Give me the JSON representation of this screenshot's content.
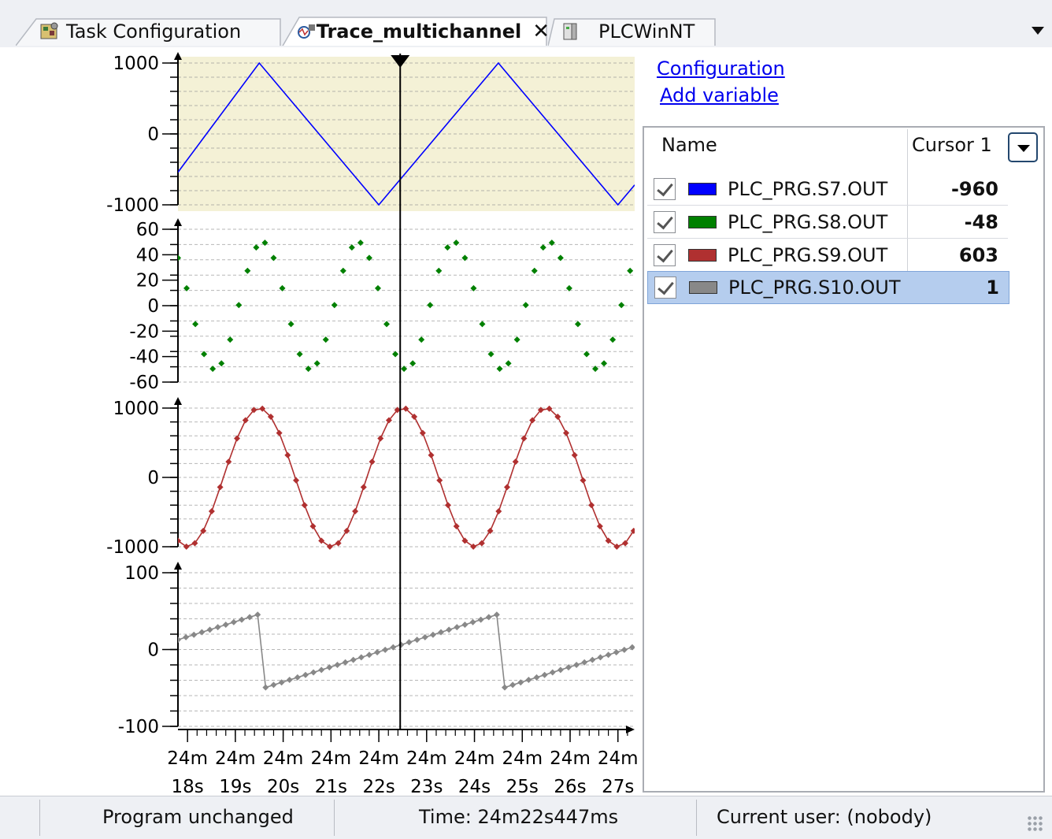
{
  "tabs": [
    {
      "label": "Task Configuration",
      "icon": "task-config-icon",
      "active": false
    },
    {
      "label": "Trace_multichannel",
      "icon": "trace-icon",
      "active": true
    },
    {
      "label": "PLCWinNT",
      "icon": "plc-device-icon",
      "active": false
    }
  ],
  "links": {
    "configuration": "Configuration",
    "add_variable": "Add variable"
  },
  "variable_list": {
    "col_name": "Name",
    "col_cursor": "Cursor 1",
    "rows": [
      {
        "name": "PLC_PRG.S7.OUT",
        "color": "#0000ff",
        "value": "-960",
        "checked": true,
        "selected": false
      },
      {
        "name": "PLC_PRG.S8.OUT",
        "color": "#008000",
        "value": "-48",
        "checked": true,
        "selected": false
      },
      {
        "name": "PLC_PRG.S9.OUT",
        "color": "#b03030",
        "value": "603",
        "checked": true,
        "selected": false
      },
      {
        "name": "PLC_PRG.S10.OUT",
        "color": "#888888",
        "value": "1",
        "checked": true,
        "selected": true
      }
    ]
  },
  "status": {
    "program": "Program unchanged",
    "time": "Time: 24m22s447ms",
    "user": "Current user: (nobody)"
  },
  "chart_data": {
    "type": "line",
    "x_unit": "seconds",
    "xlim": [
      17.8,
      27.35
    ],
    "cursor_x": 22.447,
    "x_ticks": [
      {
        "x": 18,
        "l1": "24m",
        "l2": "18s"
      },
      {
        "x": 19,
        "l1": "24m",
        "l2": "19s"
      },
      {
        "x": 20,
        "l1": "24m",
        "l2": "20s"
      },
      {
        "x": 21,
        "l1": "24m",
        "l2": "21s"
      },
      {
        "x": 22,
        "l1": "24m",
        "l2": "22s"
      },
      {
        "x": 23,
        "l1": "24m",
        "l2": "23s"
      },
      {
        "x": 24,
        "l1": "24m",
        "l2": "24s"
      },
      {
        "x": 25,
        "l1": "24m",
        "l2": "25s"
      },
      {
        "x": 26,
        "l1": "24m",
        "l2": "26s"
      },
      {
        "x": 27,
        "l1": "24m",
        "l2": "27s"
      }
    ],
    "panels": [
      {
        "series": "PLC_PRG.S7.OUT",
        "color": "#0000ff",
        "ylim": [
          -1000,
          1000
        ],
        "ticks": [
          -1000,
          0,
          1000
        ],
        "markers": false,
        "highlighted": true,
        "points": [
          [
            17.8,
            -540
          ],
          [
            19.5,
            1000
          ],
          [
            22.0,
            -1000
          ],
          [
            24.5,
            1000
          ],
          [
            27.0,
            -1000
          ],
          [
            27.35,
            -720
          ]
        ]
      },
      {
        "series": "PLC_PRG.S8.OUT",
        "color": "#008000",
        "ylim": [
          -60,
          60
        ],
        "ticks": [
          -60,
          -40,
          -20,
          0,
          20,
          40,
          60
        ],
        "markers": true,
        "line": false,
        "wave": {
          "kind": "sine",
          "amplitude": 50,
          "period": 2.0,
          "phase_x": 19.07,
          "samples": 11
        }
      },
      {
        "series": "PLC_PRG.S9.OUT",
        "color": "#b03030",
        "ylim": [
          -1000,
          1000
        ],
        "ticks": [
          -1000,
          0,
          1000
        ],
        "markers": true,
        "line": true,
        "wave": {
          "kind": "cosine",
          "amplitude": 1000,
          "period": 3.0,
          "peak_x": 19.5,
          "samples": 17
        }
      },
      {
        "series": "PLC_PRG.S10.OUT",
        "color": "#888888",
        "ylim": [
          -100,
          100
        ],
        "ticks": [
          -100,
          0,
          100
        ],
        "markers": true,
        "line": true,
        "wave": {
          "kind": "sawtooth",
          "min": -50,
          "max": 48,
          "period": 5.0,
          "drop_x": 19.6,
          "samples": 30
        }
      }
    ]
  }
}
